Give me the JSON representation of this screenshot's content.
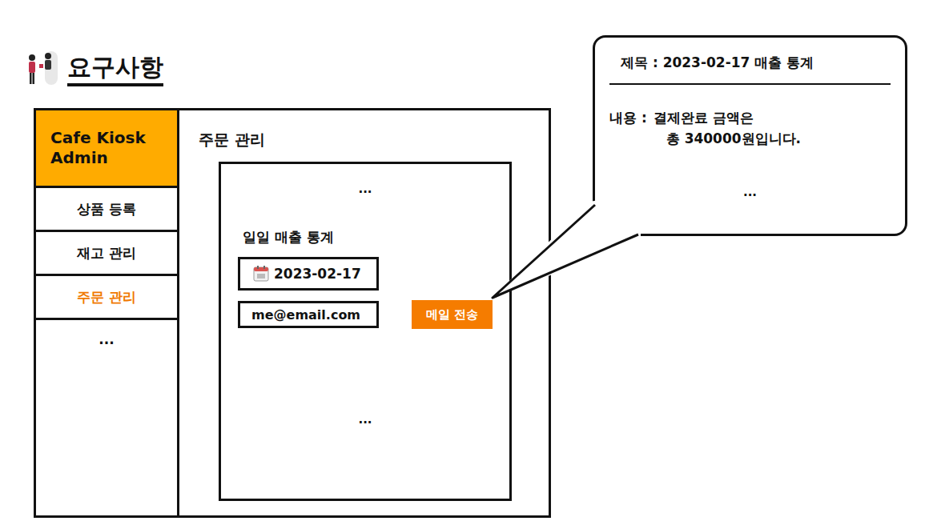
{
  "heading": "요구사항",
  "sidebar": {
    "title": "Cafe Kiosk Admin",
    "items": [
      {
        "label": "상품 등록",
        "selected": false
      },
      {
        "label": "재고 관리",
        "selected": false
      },
      {
        "label": "주문 관리",
        "selected": true
      },
      {
        "label": "...",
        "selected": false
      }
    ]
  },
  "main": {
    "title": "주문 관리",
    "top_ellipsis": "...",
    "section_title": "일일 매출 통계",
    "date": "2023-02-17",
    "email": "me@email.com",
    "button": "메일 전송",
    "bottom_ellipsis": "..."
  },
  "mail_preview": {
    "subject_label": "제목 :",
    "subject": "2023-02-17 매출 통계",
    "body_label": "내용 :",
    "body_lines": [
      "결제완료 금액은",
      "총 340000원입니다."
    ],
    "ellipsis": "..."
  }
}
